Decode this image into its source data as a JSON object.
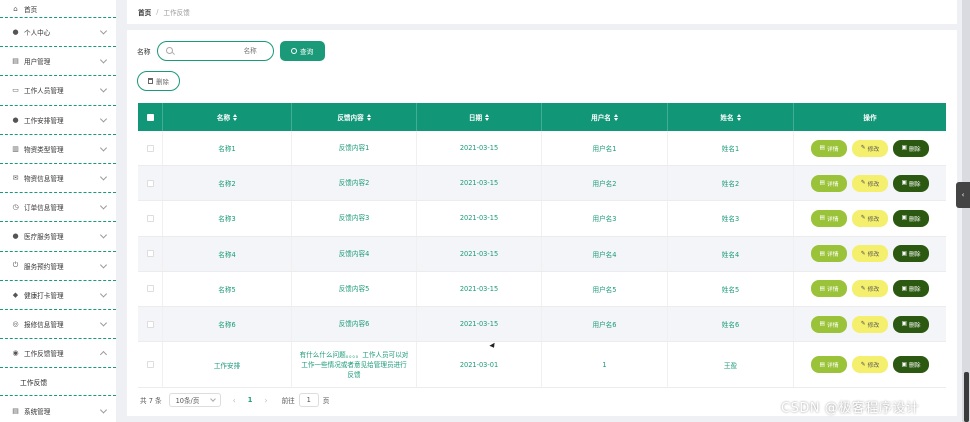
{
  "sidebar": {
    "items": [
      {
        "label": "首页",
        "icon": "home-icon",
        "glyph": "⌂",
        "expandable": false
      },
      {
        "label": "个人中心",
        "icon": "user-icon",
        "glyph": "●",
        "expandable": true
      },
      {
        "label": "用户管理",
        "icon": "clipboard-icon",
        "glyph": "▤",
        "expandable": true
      },
      {
        "label": "工作人员管理",
        "icon": "id-card-icon",
        "glyph": "▭",
        "expandable": true
      },
      {
        "label": "工作安排管理",
        "icon": "user-icon",
        "glyph": "●",
        "expandable": true
      },
      {
        "label": "物资类型管理",
        "icon": "archive-icon",
        "glyph": "▥",
        "expandable": true
      },
      {
        "label": "物资信息管理",
        "icon": "mail-icon",
        "glyph": "✉",
        "expandable": true
      },
      {
        "label": "订单信息管理",
        "icon": "clock-icon",
        "glyph": "◷",
        "expandable": true
      },
      {
        "label": "医疗服务管理",
        "icon": "user-icon",
        "glyph": "●",
        "expandable": true
      },
      {
        "label": "服务预约管理",
        "icon": "power-icon",
        "glyph": "⏻",
        "expandable": true
      },
      {
        "label": "健康打卡管理",
        "icon": "location-icon",
        "glyph": "◆",
        "expandable": true
      },
      {
        "label": "报修信息管理",
        "icon": "target-icon",
        "glyph": "◎",
        "expandable": true
      },
      {
        "label": "工作反馈管理",
        "icon": "compass-icon",
        "glyph": "◉",
        "expandable": true,
        "expanded": true
      }
    ],
    "submenu_label": "工作反馈",
    "last_item": {
      "label": "系统管理",
      "icon": "clipboard-icon",
      "glyph": "▤"
    }
  },
  "breadcrumb": {
    "home": "首页",
    "separator": "/",
    "current": "工作反馈"
  },
  "search": {
    "label": "名称",
    "placeholder": "名称",
    "query_button": "查询",
    "delete_button": "删除"
  },
  "table": {
    "columns": [
      "名称",
      "反馈内容",
      "日期",
      "用户名",
      "姓名",
      "操作"
    ],
    "rows": [
      {
        "name": "名称1",
        "content": "反馈内容1",
        "date": "2021-03-15",
        "username": "用户名1",
        "realname": "姓名1"
      },
      {
        "name": "名称2",
        "content": "反馈内容2",
        "date": "2021-03-15",
        "username": "用户名2",
        "realname": "姓名2"
      },
      {
        "name": "名称3",
        "content": "反馈内容3",
        "date": "2021-03-15",
        "username": "用户名3",
        "realname": "姓名3"
      },
      {
        "name": "名称4",
        "content": "反馈内容4",
        "date": "2021-03-15",
        "username": "用户名4",
        "realname": "姓名4"
      },
      {
        "name": "名称5",
        "content": "反馈内容5",
        "date": "2021-03-15",
        "username": "用户名5",
        "realname": "姓名5"
      },
      {
        "name": "名称6",
        "content": "反馈内容6",
        "date": "2021-03-15",
        "username": "用户名6",
        "realname": "姓名6"
      },
      {
        "name": "工作安排",
        "content": "有什么什么问题。。。。工作人员可以对工作一些情况或者意见给管理员进行反馈",
        "date": "2021-03-01",
        "username": "1",
        "realname": "王盈"
      }
    ],
    "actions": {
      "detail": "详情",
      "edit": "修改",
      "delete": "删除"
    }
  },
  "pagination": {
    "total": "共 7 条",
    "page_size": "10条/页",
    "current_page": "1",
    "goto_label": "前往",
    "goto_value": "1",
    "goto_suffix": "页"
  },
  "watermark": "CSDN @极客程序设计",
  "colors": {
    "primary": "#1a9a78",
    "header": "#129678",
    "detail": "#9bc33a",
    "edit": "#f4ef6d",
    "delete": "#2c5911"
  }
}
